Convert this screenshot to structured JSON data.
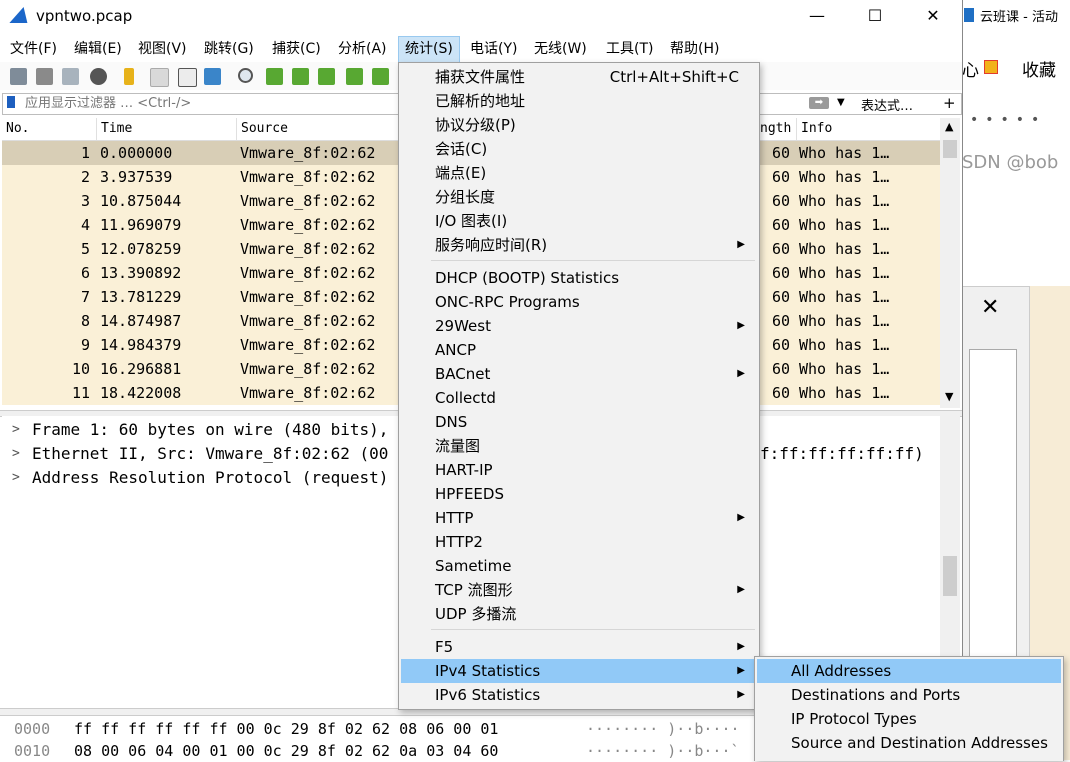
{
  "window": {
    "title": "vpntwo.pcap",
    "controls": {
      "minimize": "—",
      "maximize": "☐",
      "close": "✕"
    }
  },
  "background_app": {
    "title": "云班课 - 活动",
    "fav_label": "收藏",
    "heart_text": "心",
    "watermark": "SDN @bob",
    "dialog_close": "✕"
  },
  "menubar": [
    "文件(F)",
    "编辑(E)",
    "视图(V)",
    "跳转(G)",
    "捕获(C)",
    "分析(A)",
    "统计(S)",
    "电话(Y)",
    "无线(W)",
    "工具(T)",
    "帮助(H)"
  ],
  "filter": {
    "placeholder": "应用显示过滤器 … <Ctrl-/>",
    "expression_label": "表达式…",
    "plus": "+"
  },
  "packet_list": {
    "columns": {
      "no": "No.",
      "time": "Time",
      "source": "Source",
      "length": "ngth",
      "info": "Info"
    },
    "rows": [
      {
        "no": "1",
        "time": "0.000000",
        "source": "Vmware_8f:02:62",
        "length": "60",
        "info": "Who has 1…"
      },
      {
        "no": "2",
        "time": "3.937539",
        "source": "Vmware_8f:02:62",
        "length": "60",
        "info": "Who has 1…"
      },
      {
        "no": "3",
        "time": "10.875044",
        "source": "Vmware_8f:02:62",
        "length": "60",
        "info": "Who has 1…"
      },
      {
        "no": "4",
        "time": "11.969079",
        "source": "Vmware_8f:02:62",
        "length": "60",
        "info": "Who has 1…"
      },
      {
        "no": "5",
        "time": "12.078259",
        "source": "Vmware_8f:02:62",
        "length": "60",
        "info": "Who has 1…"
      },
      {
        "no": "6",
        "time": "13.390892",
        "source": "Vmware_8f:02:62",
        "length": "60",
        "info": "Who has 1…"
      },
      {
        "no": "7",
        "time": "13.781229",
        "source": "Vmware_8f:02:62",
        "length": "60",
        "info": "Who has 1…"
      },
      {
        "no": "8",
        "time": "14.874987",
        "source": "Vmware_8f:02:62",
        "length": "60",
        "info": "Who has 1…"
      },
      {
        "no": "9",
        "time": "14.984379",
        "source": "Vmware_8f:02:62",
        "length": "60",
        "info": "Who has 1…"
      },
      {
        "no": "10",
        "time": "16.296881",
        "source": "Vmware_8f:02:62",
        "length": "60",
        "info": "Who has 1…"
      },
      {
        "no": "11",
        "time": "18.422008",
        "source": "Vmware_8f:02:62",
        "length": "60",
        "info": "Who has 1…"
      }
    ]
  },
  "details": [
    {
      "text": "Frame 1: 60 bytes on wire (480 bits),",
      "tail": ""
    },
    {
      "text": "Ethernet II, Src: Vmware_8f:02:62 (00",
      "tail": "f:ff:ff:ff:ff:ff)"
    },
    {
      "text": "Address Resolution Protocol (request)",
      "tail": ""
    }
  ],
  "bytes": [
    {
      "offset": "0000",
      "hex": "ff ff ff ff ff ff 00 0c  29 8f 02 62 08 06 00 01",
      "ascii": "········ )··b····"
    },
    {
      "offset": "0010",
      "hex": "08 00 06 04 00 01 00 0c  29 8f 02 62 0a 03 04 60",
      "ascii": "········ )··b···`"
    }
  ],
  "stats_menu": {
    "items": [
      {
        "label": "捕获文件属性",
        "shortcut": "Ctrl+Alt+Shift+C",
        "submenu": false
      },
      {
        "label": "已解析的地址",
        "shortcut": "",
        "submenu": false
      },
      {
        "label": "协议分级(P)",
        "shortcut": "",
        "submenu": false
      },
      {
        "label": "会话(C)",
        "shortcut": "",
        "submenu": false
      },
      {
        "label": "端点(E)",
        "shortcut": "",
        "submenu": false
      },
      {
        "label": "分组长度",
        "shortcut": "",
        "submenu": false
      },
      {
        "label": "I/O 图表(I)",
        "shortcut": "",
        "submenu": false
      },
      {
        "label": "服务响应时间(R)",
        "shortcut": "",
        "submenu": true
      },
      {
        "label": "DHCP (BOOTP) Statistics",
        "shortcut": "",
        "submenu": false
      },
      {
        "label": "ONC-RPC Programs",
        "shortcut": "",
        "submenu": false
      },
      {
        "label": "29West",
        "shortcut": "",
        "submenu": true
      },
      {
        "label": "ANCP",
        "shortcut": "",
        "submenu": false
      },
      {
        "label": "BACnet",
        "shortcut": "",
        "submenu": true
      },
      {
        "label": "Collectd",
        "shortcut": "",
        "submenu": false
      },
      {
        "label": "DNS",
        "shortcut": "",
        "submenu": false
      },
      {
        "label": "流量图",
        "shortcut": "",
        "submenu": false
      },
      {
        "label": "HART-IP",
        "shortcut": "",
        "submenu": false
      },
      {
        "label": "HPFEEDS",
        "shortcut": "",
        "submenu": false
      },
      {
        "label": "HTTP",
        "shortcut": "",
        "submenu": true
      },
      {
        "label": "HTTP2",
        "shortcut": "",
        "submenu": false
      },
      {
        "label": "Sametime",
        "shortcut": "",
        "submenu": false
      },
      {
        "label": "TCP 流图形",
        "shortcut": "",
        "submenu": true
      },
      {
        "label": "UDP 多播流",
        "shortcut": "",
        "submenu": false
      },
      {
        "label": "F5",
        "shortcut": "",
        "submenu": true
      },
      {
        "label": "IPv4 Statistics",
        "shortcut": "",
        "submenu": true
      },
      {
        "label": "IPv6 Statistics",
        "shortcut": "",
        "submenu": true
      }
    ],
    "arrow": "▶"
  },
  "ipv4_menu": {
    "items": [
      "All Addresses",
      "Destinations and Ports",
      "IP Protocol Types",
      "Source and Destination Addresses"
    ]
  },
  "colors": {
    "row_bg": "#faf0d7",
    "row_selected": "#d8ceb6",
    "menu_highlight": "#91c9f7",
    "menubar_active": "#cce4f7"
  }
}
